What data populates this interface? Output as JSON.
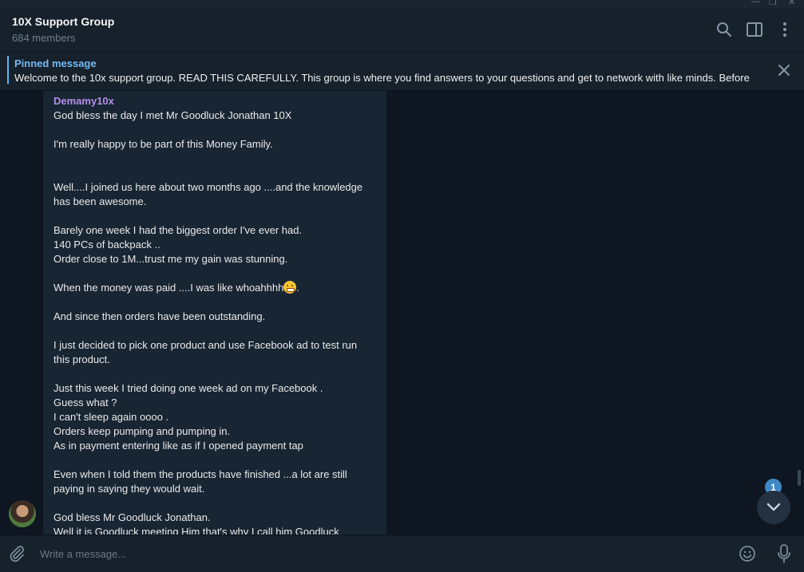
{
  "window": {
    "minimize_glyph": "—",
    "maximize_glyph": "❐",
    "close_glyph": "✕"
  },
  "header": {
    "title": "10X Support Group",
    "subtitle": "684 members",
    "icons": [
      "search-icon",
      "sidebar-toggle-icon",
      "more-vertical-icon"
    ]
  },
  "pinned": {
    "label": "Pinned message",
    "text": "Welcome to the 10x support group.  READ THIS CAREFULLY.   This group is where you find answers to your questions and get to network with like minds.  Before",
    "close_icon": "close-icon"
  },
  "message": {
    "sender": "Demamy10x",
    "sender_color": "#b48ee6",
    "lines": [
      "God bless the day I met Mr Goodluck Jonathan 10X",
      "",
      "I'm really happy to be part of this Money Family.",
      "",
      "",
      "Well....I joined us here about two months ago ....and the knowledge",
      "has been awesome.",
      "",
      "Barely one week I had the biggest order I've ever had.",
      "140 PCs of backpack ..",
      "Order close to 1M...trust me my gain was stunning.",
      "",
      "When the money was paid ....I was like whoahhhh",
      "",
      "And since then orders have been outstanding.",
      "",
      "I just decided to pick one product and use Facebook ad to test run",
      "this product.",
      "",
      "Just this week I tried doing one week ad on my Facebook .",
      "Guess what ?",
      "I can't sleep again oooo .",
      "Orders keep pumping and pumping in.",
      "As in payment entering like as if I opened payment tap",
      "",
      "Even when I told them the products have finished ...a lot are still",
      "paying in saying they would wait.",
      "",
      "God bless Mr Goodluck Jonathan.",
      "Well it is Goodluck meeting Him that's why I call him Goodluck"
    ],
    "emoji_suffix": "."
  },
  "scroll_down": {
    "unread_count": "1"
  },
  "composer": {
    "placeholder": "Write a message...",
    "icons": [
      "attach-icon",
      "emoji-icon",
      "microphone-icon"
    ]
  },
  "colors": {
    "background": "#0e1621",
    "panel": "#17212b",
    "bubble": "#182533",
    "accent": "#5eb5f7",
    "badge": "#3f88c5"
  }
}
